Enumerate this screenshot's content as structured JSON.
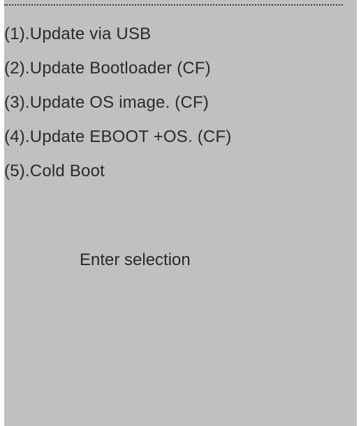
{
  "menu": {
    "items": [
      {
        "label": "(1).Update via USB"
      },
      {
        "label": "(2).Update Bootloader (CF)"
      },
      {
        "label": "(3).Update OS image. (CF)"
      },
      {
        "label": "(4).Update EBOOT +OS. (CF)"
      },
      {
        "label": "(5).Cold Boot"
      }
    ]
  },
  "prompt": {
    "text": "Enter selection"
  },
  "colors": {
    "screen_background": "#c0c0c0",
    "text": "#2a2a2a"
  }
}
